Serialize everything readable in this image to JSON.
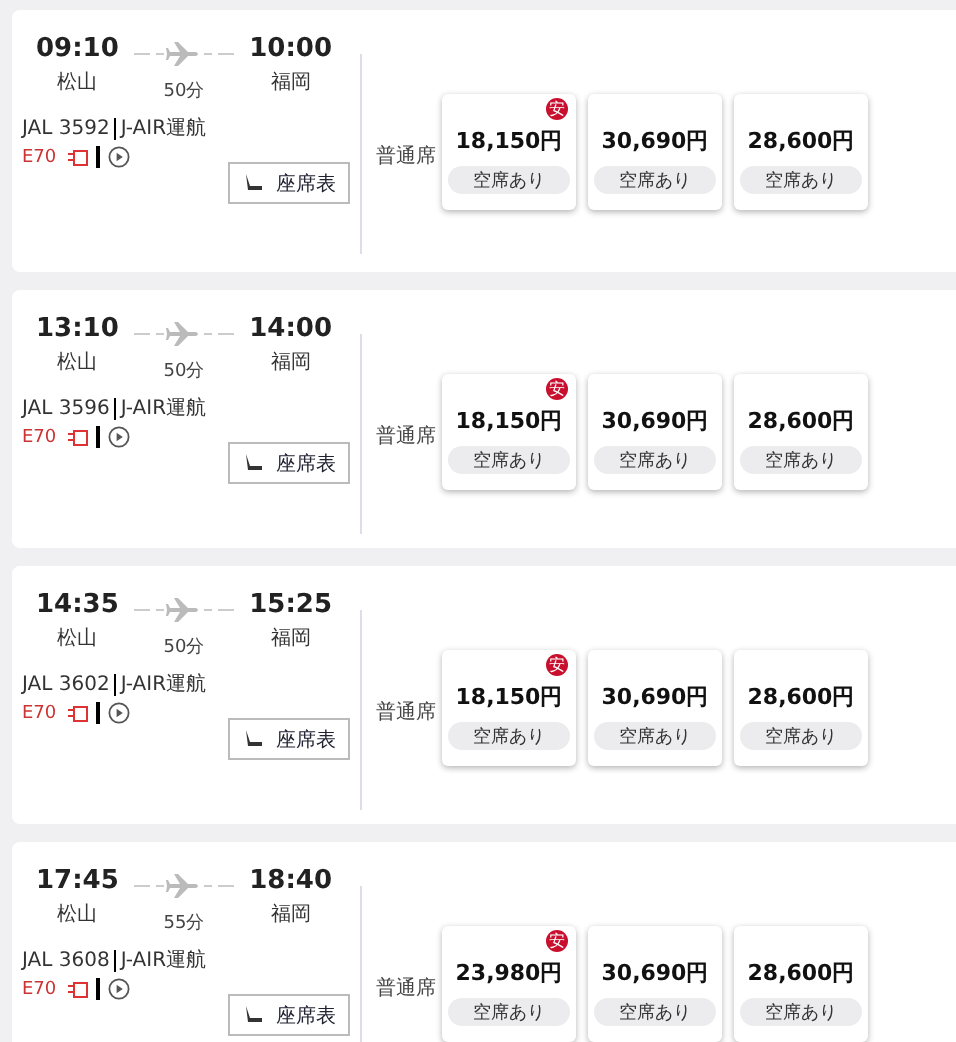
{
  "flights": [
    {
      "dep_time": "09:10",
      "dep_airport": "松山",
      "duration": "50分",
      "arr_time": "10:00",
      "arr_airport": "福岡",
      "flight_no": "JAL 3592",
      "operator": "J-AIR運航",
      "aircraft": "E70",
      "seat_map": "座席表",
      "cabin": "普通席",
      "fares": [
        {
          "price": "18,150円",
          "availability": "空席あり",
          "badge": "安"
        },
        {
          "price": "30,690円",
          "availability": "空席あり"
        },
        {
          "price": "28,600円",
          "availability": "空席あり"
        }
      ]
    },
    {
      "dep_time": "13:10",
      "dep_airport": "松山",
      "duration": "50分",
      "arr_time": "14:00",
      "arr_airport": "福岡",
      "flight_no": "JAL 3596",
      "operator": "J-AIR運航",
      "aircraft": "E70",
      "seat_map": "座席表",
      "cabin": "普通席",
      "fares": [
        {
          "price": "18,150円",
          "availability": "空席あり",
          "badge": "安"
        },
        {
          "price": "30,690円",
          "availability": "空席あり"
        },
        {
          "price": "28,600円",
          "availability": "空席あり"
        }
      ]
    },
    {
      "dep_time": "14:35",
      "dep_airport": "松山",
      "duration": "50分",
      "arr_time": "15:25",
      "arr_airport": "福岡",
      "flight_no": "JAL 3602",
      "operator": "J-AIR運航",
      "aircraft": "E70",
      "seat_map": "座席表",
      "cabin": "普通席",
      "fares": [
        {
          "price": "18,150円",
          "availability": "空席あり",
          "badge": "安"
        },
        {
          "price": "30,690円",
          "availability": "空席あり"
        },
        {
          "price": "28,600円",
          "availability": "空席あり"
        }
      ]
    },
    {
      "dep_time": "17:45",
      "dep_airport": "松山",
      "duration": "55分",
      "arr_time": "18:40",
      "arr_airport": "福岡",
      "flight_no": "JAL 3608",
      "operator": "J-AIR運航",
      "aircraft": "E70",
      "seat_map": "座席表",
      "cabin": "普通席",
      "fares": [
        {
          "price": "23,980円",
          "availability": "空席あり",
          "badge": "安"
        },
        {
          "price": "30,690円",
          "availability": "空席あり"
        },
        {
          "price": "28,600円",
          "availability": "空席あり"
        }
      ]
    }
  ]
}
